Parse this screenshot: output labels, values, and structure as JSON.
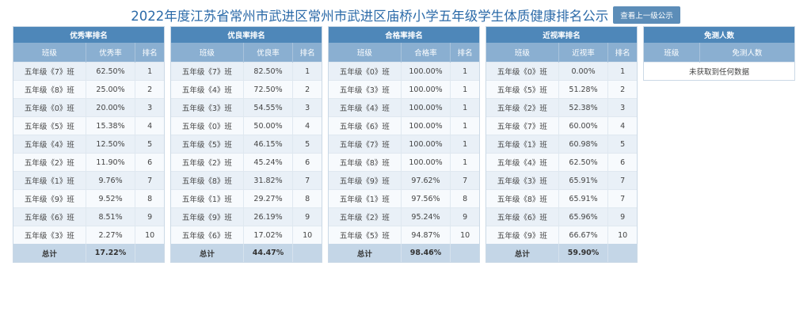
{
  "header": {
    "title": "2022年度江苏省常州市武进区常州市武进区庙桥小学五年级学生体质健康排名公示",
    "prev_button": "查看上一级公示"
  },
  "columns_common": {
    "class": "班级",
    "rank": "排名",
    "total": "总计"
  },
  "excellent": {
    "title": "优秀率排名",
    "rate_label": "优秀率",
    "rows": [
      {
        "cls": "五年级《7》班",
        "rate": "62.50%",
        "rank": "1"
      },
      {
        "cls": "五年级《8》班",
        "rate": "25.00%",
        "rank": "2"
      },
      {
        "cls": "五年级《0》班",
        "rate": "20.00%",
        "rank": "3"
      },
      {
        "cls": "五年级《5》班",
        "rate": "15.38%",
        "rank": "4"
      },
      {
        "cls": "五年级《4》班",
        "rate": "12.50%",
        "rank": "5"
      },
      {
        "cls": "五年级《2》班",
        "rate": "11.90%",
        "rank": "6"
      },
      {
        "cls": "五年级《1》班",
        "rate": "9.76%",
        "rank": "7"
      },
      {
        "cls": "五年级《9》班",
        "rate": "9.52%",
        "rank": "8"
      },
      {
        "cls": "五年级《6》班",
        "rate": "8.51%",
        "rank": "9"
      },
      {
        "cls": "五年级《3》班",
        "rate": "2.27%",
        "rank": "10"
      }
    ],
    "total": "17.22%"
  },
  "good": {
    "title": "优良率排名",
    "rate_label": "优良率",
    "rows": [
      {
        "cls": "五年级《7》班",
        "rate": "82.50%",
        "rank": "1"
      },
      {
        "cls": "五年级《4》班",
        "rate": "72.50%",
        "rank": "2"
      },
      {
        "cls": "五年级《3》班",
        "rate": "54.55%",
        "rank": "3"
      },
      {
        "cls": "五年级《0》班",
        "rate": "50.00%",
        "rank": "4"
      },
      {
        "cls": "五年级《5》班",
        "rate": "46.15%",
        "rank": "5"
      },
      {
        "cls": "五年级《2》班",
        "rate": "45.24%",
        "rank": "6"
      },
      {
        "cls": "五年级《8》班",
        "rate": "31.82%",
        "rank": "7"
      },
      {
        "cls": "五年级《1》班",
        "rate": "29.27%",
        "rank": "8"
      },
      {
        "cls": "五年级《9》班",
        "rate": "26.19%",
        "rank": "9"
      },
      {
        "cls": "五年级《6》班",
        "rate": "17.02%",
        "rank": "10"
      }
    ],
    "total": "44.47%"
  },
  "pass": {
    "title": "合格率排名",
    "rate_label": "合格率",
    "rows": [
      {
        "cls": "五年级《0》班",
        "rate": "100.00%",
        "rank": "1"
      },
      {
        "cls": "五年级《3》班",
        "rate": "100.00%",
        "rank": "1"
      },
      {
        "cls": "五年级《4》班",
        "rate": "100.00%",
        "rank": "1"
      },
      {
        "cls": "五年级《6》班",
        "rate": "100.00%",
        "rank": "1"
      },
      {
        "cls": "五年级《7》班",
        "rate": "100.00%",
        "rank": "1"
      },
      {
        "cls": "五年级《8》班",
        "rate": "100.00%",
        "rank": "1"
      },
      {
        "cls": "五年级《9》班",
        "rate": "97.62%",
        "rank": "7"
      },
      {
        "cls": "五年级《1》班",
        "rate": "97.56%",
        "rank": "8"
      },
      {
        "cls": "五年级《2》班",
        "rate": "95.24%",
        "rank": "9"
      },
      {
        "cls": "五年级《5》班",
        "rate": "94.87%",
        "rank": "10"
      }
    ],
    "total": "98.46%"
  },
  "myopia": {
    "title": "近视率排名",
    "rate_label": "近视率",
    "rows": [
      {
        "cls": "五年级《0》班",
        "rate": "0.00%",
        "rank": "1"
      },
      {
        "cls": "五年级《5》班",
        "rate": "51.28%",
        "rank": "2"
      },
      {
        "cls": "五年级《2》班",
        "rate": "52.38%",
        "rank": "3"
      },
      {
        "cls": "五年级《7》班",
        "rate": "60.00%",
        "rank": "4"
      },
      {
        "cls": "五年级《1》班",
        "rate": "60.98%",
        "rank": "5"
      },
      {
        "cls": "五年级《4》班",
        "rate": "62.50%",
        "rank": "6"
      },
      {
        "cls": "五年级《3》班",
        "rate": "65.91%",
        "rank": "7"
      },
      {
        "cls": "五年级《8》班",
        "rate": "65.91%",
        "rank": "7"
      },
      {
        "cls": "五年级《6》班",
        "rate": "65.96%",
        "rank": "9"
      },
      {
        "cls": "五年级《9》班",
        "rate": "66.67%",
        "rank": "10"
      }
    ],
    "total": "59.90%"
  },
  "exempt": {
    "title": "免测人数",
    "col_class": "班级",
    "col_count": "免测人数",
    "empty_text": "未获取到任何数据"
  },
  "colors": {
    "title": "#2b6aa8",
    "panel_header": "#4e87b9",
    "column_header": "#8aafd1",
    "button": "#5c8db8",
    "total_row": "#c4d6e7"
  }
}
